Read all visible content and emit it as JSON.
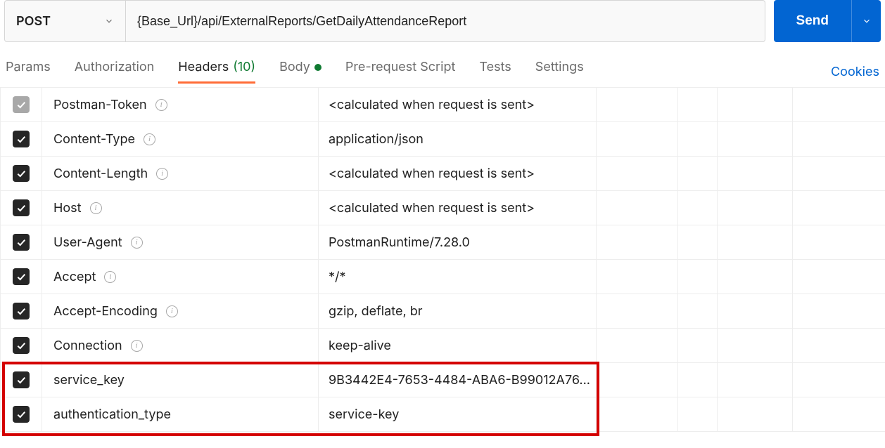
{
  "request": {
    "method": "POST",
    "url": "{Base_Url}/api/ExternalReports/GetDailyAttendanceReport",
    "send_label": "Send"
  },
  "tabs": {
    "params": "Params",
    "authorization": "Authorization",
    "headers_label": "Headers",
    "headers_count": "(10)",
    "body": "Body",
    "prerequest": "Pre-request Script",
    "tests": "Tests",
    "settings": "Settings",
    "cookies": "Cookies"
  },
  "headers": [
    {
      "enabled": "disabled",
      "key": "Postman-Token",
      "info": true,
      "value": "<calculated when request is sent>"
    },
    {
      "enabled": "on",
      "key": "Content-Type",
      "info": true,
      "value": "application/json"
    },
    {
      "enabled": "on",
      "key": "Content-Length",
      "info": true,
      "value": "<calculated when request is sent>"
    },
    {
      "enabled": "on",
      "key": "Host",
      "info": true,
      "value": "<calculated when request is sent>"
    },
    {
      "enabled": "on",
      "key": "User-Agent",
      "info": true,
      "value": "PostmanRuntime/7.28.0"
    },
    {
      "enabled": "on",
      "key": "Accept",
      "info": true,
      "value": "*/*"
    },
    {
      "enabled": "on",
      "key": "Accept-Encoding",
      "info": true,
      "value": "gzip, deflate, br"
    },
    {
      "enabled": "on",
      "key": "Connection",
      "info": true,
      "value": "keep-alive"
    },
    {
      "enabled": "on",
      "key": "service_key",
      "info": false,
      "value": "9B3442E4-7653-4484-ABA6-B99012A76..."
    },
    {
      "enabled": "on",
      "key": "authentication_type",
      "info": false,
      "value": "service-key"
    }
  ]
}
